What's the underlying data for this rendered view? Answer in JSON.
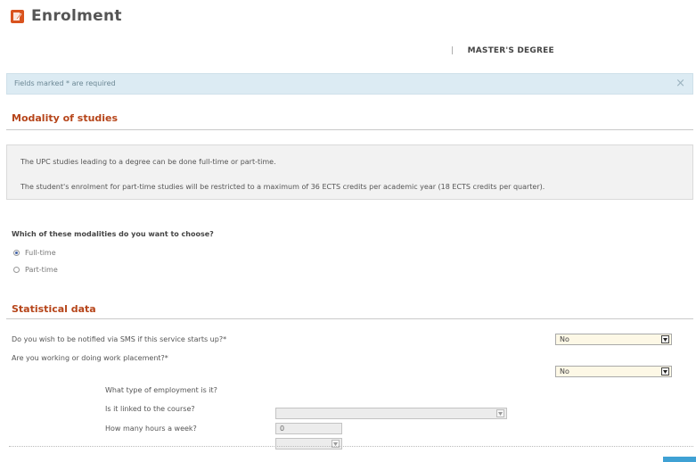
{
  "page": {
    "title": "Enrolment",
    "degree_label": "MASTER'S DEGREE",
    "degree_separator": "|"
  },
  "notice": {
    "text": "Fields marked * are required",
    "close": "×"
  },
  "modality": {
    "section_title": "Modality of studies",
    "info_lines": [
      "The UPC studies leading to a degree can be done full-time or part-time.",
      "The student's enrolment for part-time studies will be restricted to a maximum of 36 ECTS credits per academic year (18 ECTS credits per quarter)."
    ],
    "question": "Which of these modalities do you want to choose?",
    "options": [
      {
        "label": "Full-time",
        "checked": true
      },
      {
        "label": "Part-time",
        "checked": false
      }
    ]
  },
  "statistical": {
    "section_title": "Statistical data",
    "sms_label": "Do you wish to be notified via SMS if this service starts up?*",
    "sms_value": "No",
    "working_label": "Are you working or doing work placement?*",
    "working_value": "No",
    "employment_type_label": "What type of employment is it?",
    "employment_type_value": "",
    "linked_label": "Is it linked to the course?",
    "linked_value": "",
    "hours_label": "How many hours a week?",
    "hours_value": "0"
  },
  "colors": {
    "accent": "#b6451a",
    "notice_bg": "#dcebf3",
    "icon_bg": "#d9531e",
    "button": "#3fa1d4"
  }
}
